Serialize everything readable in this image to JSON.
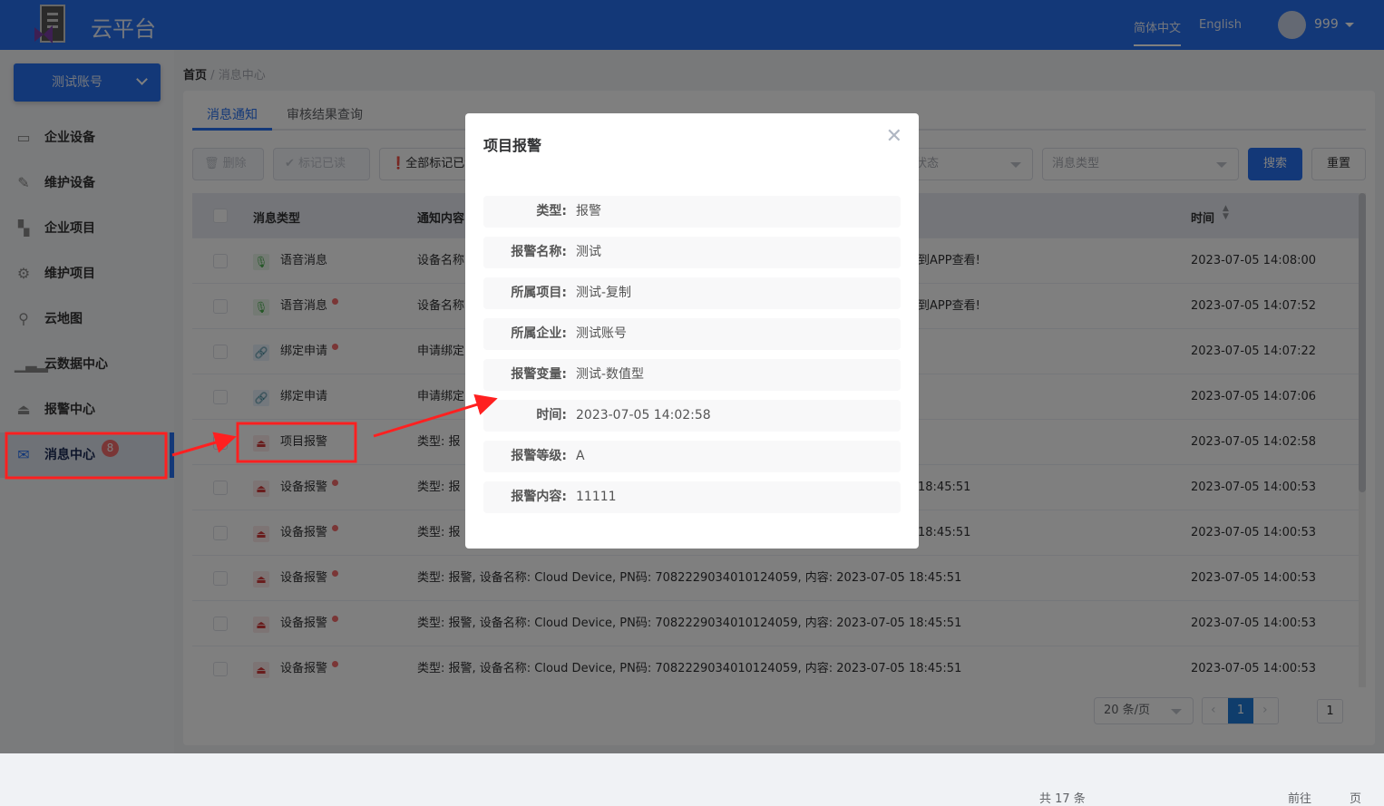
{
  "header": {
    "app_title": "云平台",
    "lang_zh": "简体中文",
    "lang_en": "English",
    "username": "999"
  },
  "sidebar": {
    "account": "测试账号",
    "items": [
      {
        "label": "企业设备",
        "icon": "monitor-icon"
      },
      {
        "label": "维护设备",
        "icon": "wrench-icon"
      },
      {
        "label": "企业项目",
        "icon": "project-icon"
      },
      {
        "label": "维护项目",
        "icon": "gear-icon"
      },
      {
        "label": "云地图",
        "icon": "map-pin-icon"
      },
      {
        "label": "云数据中心",
        "icon": "bar-chart-icon"
      },
      {
        "label": "报警中心",
        "icon": "alarm-icon"
      },
      {
        "label": "消息中心",
        "icon": "mail-icon",
        "badge": "8",
        "active": true
      }
    ]
  },
  "breadcrumb": {
    "home": "首页",
    "sep": "/",
    "current": "消息中心"
  },
  "tabs": [
    "消息通知",
    "审核结果查询"
  ],
  "toolbar": {
    "delete": "删除",
    "mark_read": "标记已读",
    "mark_all": "全部标记已读",
    "status_placeholder": "消息状态",
    "type_placeholder": "消息类型",
    "search": "搜索",
    "reset": "重置"
  },
  "table": {
    "headers": {
      "type": "消息类型",
      "content": "通知内容",
      "time": "时间"
    },
    "rows": [
      {
        "type": "语音消息",
        "kind": "voice",
        "unread": false,
        "content": "设备名称",
        "suffix": "到APP查看!",
        "time": "2023-07-05 14:08:00"
      },
      {
        "type": "语音消息",
        "kind": "voice",
        "unread": true,
        "content": "设备名称",
        "suffix": "到APP查看!",
        "time": "2023-07-05 14:07:52"
      },
      {
        "type": "绑定申请",
        "kind": "link",
        "unread": true,
        "content": "申请绑定",
        "suffix": "",
        "time": "2023-07-05 14:07:22"
      },
      {
        "type": "绑定申请",
        "kind": "link",
        "unread": false,
        "content": "申请绑定",
        "suffix": "",
        "time": "2023-07-05 14:07:06"
      },
      {
        "type": "项目报警",
        "kind": "alarm",
        "unread": false,
        "content": "类型: 报",
        "suffix": "",
        "time": "2023-07-05 14:02:58"
      },
      {
        "type": "设备报警",
        "kind": "alarm",
        "unread": true,
        "content": "类型: 报",
        "suffix": "18:45:51",
        "time": "2023-07-05 14:00:53"
      },
      {
        "type": "设备报警",
        "kind": "alarm",
        "unread": true,
        "content": "类型: 报",
        "suffix": "18:45:51",
        "time": "2023-07-05 14:00:53"
      },
      {
        "type": "设备报警",
        "kind": "alarm",
        "unread": true,
        "content": "类型: 报警, 设备名称: Cloud Device, PN码: 7082229034010124059, 内容: 2023-07-05 18:45:51",
        "suffix": "",
        "time": "2023-07-05 14:00:53"
      },
      {
        "type": "设备报警",
        "kind": "alarm",
        "unread": true,
        "content": "类型: 报警, 设备名称: Cloud Device, PN码: 7082229034010124059, 内容: 2023-07-05 18:45:51",
        "suffix": "",
        "time": "2023-07-05 14:00:53"
      },
      {
        "type": "设备报警",
        "kind": "alarm",
        "unread": true,
        "content": "类型: 报警, 设备名称: Cloud Device, PN码: 7082229034010124059, 内容: 2023-07-05 18:45:51",
        "suffix": "",
        "time": "2023-07-05 14:00:53"
      }
    ]
  },
  "pagination": {
    "total": "共 17 条",
    "page_size": "20 条/页",
    "current": "1",
    "goto_label": "前往",
    "goto_value": "1",
    "page_unit": "页"
  },
  "modal": {
    "title": "项目报警",
    "fields": [
      {
        "label": "类型:",
        "value": "报警"
      },
      {
        "label": "报警名称:",
        "value": "测试"
      },
      {
        "label": "所属项目:",
        "value": "测试-复制"
      },
      {
        "label": "所属企业:",
        "value": "测试账号"
      },
      {
        "label": "报警变量:",
        "value": "测试-数值型"
      },
      {
        "label": "时间:",
        "value": "2023-07-05 14:02:58"
      },
      {
        "label": "报警等级:",
        "value": "A"
      },
      {
        "label": "报警内容:",
        "value": "11111"
      }
    ]
  },
  "colors": {
    "brand": "#2670f0",
    "unread_dot": "#f56c6c",
    "annotation": "#ff2020"
  }
}
